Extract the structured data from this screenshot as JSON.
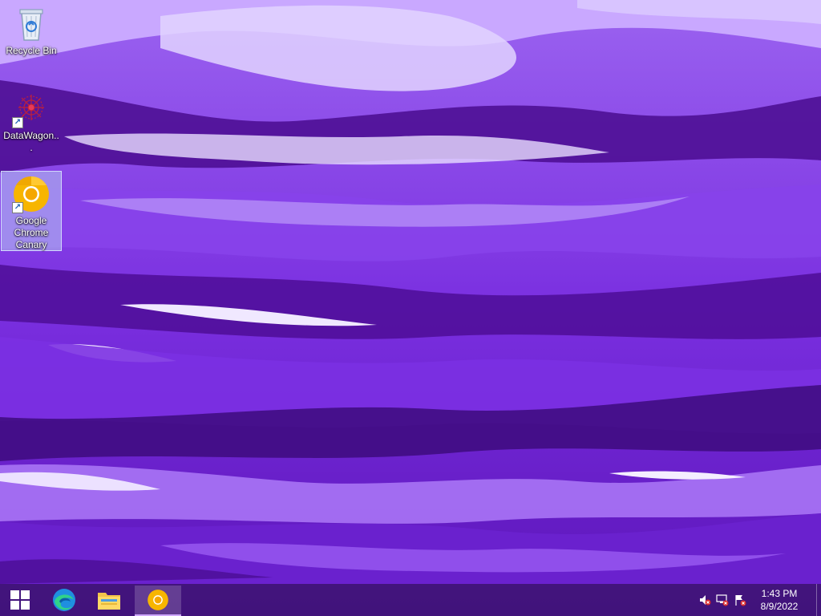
{
  "desktop": {
    "icons": [
      {
        "label": "Recycle Bin",
        "icon": "recycle-bin-icon"
      },
      {
        "label": "DataWagon...",
        "icon": "datawagon-icon"
      },
      {
        "label": "Google Chrome Canary",
        "icon": "chrome-canary-icon",
        "selected": true
      }
    ]
  },
  "taskbar": {
    "start_icon": "windows-start-icon",
    "pinned": [
      {
        "name": "Microsoft Edge",
        "icon": "edge-icon"
      },
      {
        "name": "File Explorer",
        "icon": "file-explorer-icon"
      },
      {
        "name": "Google Chrome Canary",
        "icon": "chrome-canary-icon",
        "active": true
      }
    ],
    "tray": {
      "icons": [
        "volume-muted-icon",
        "network-disconnected-icon",
        "action-center-flag-icon"
      ],
      "time": "1:43 PM",
      "date": "8/9/2022"
    }
  },
  "colors": {
    "wallpaper_base": "#6a1fc9",
    "taskbar": "#3c146e",
    "canary_yellow": "#f7b500",
    "edge_blue": "#1f8fe0"
  }
}
